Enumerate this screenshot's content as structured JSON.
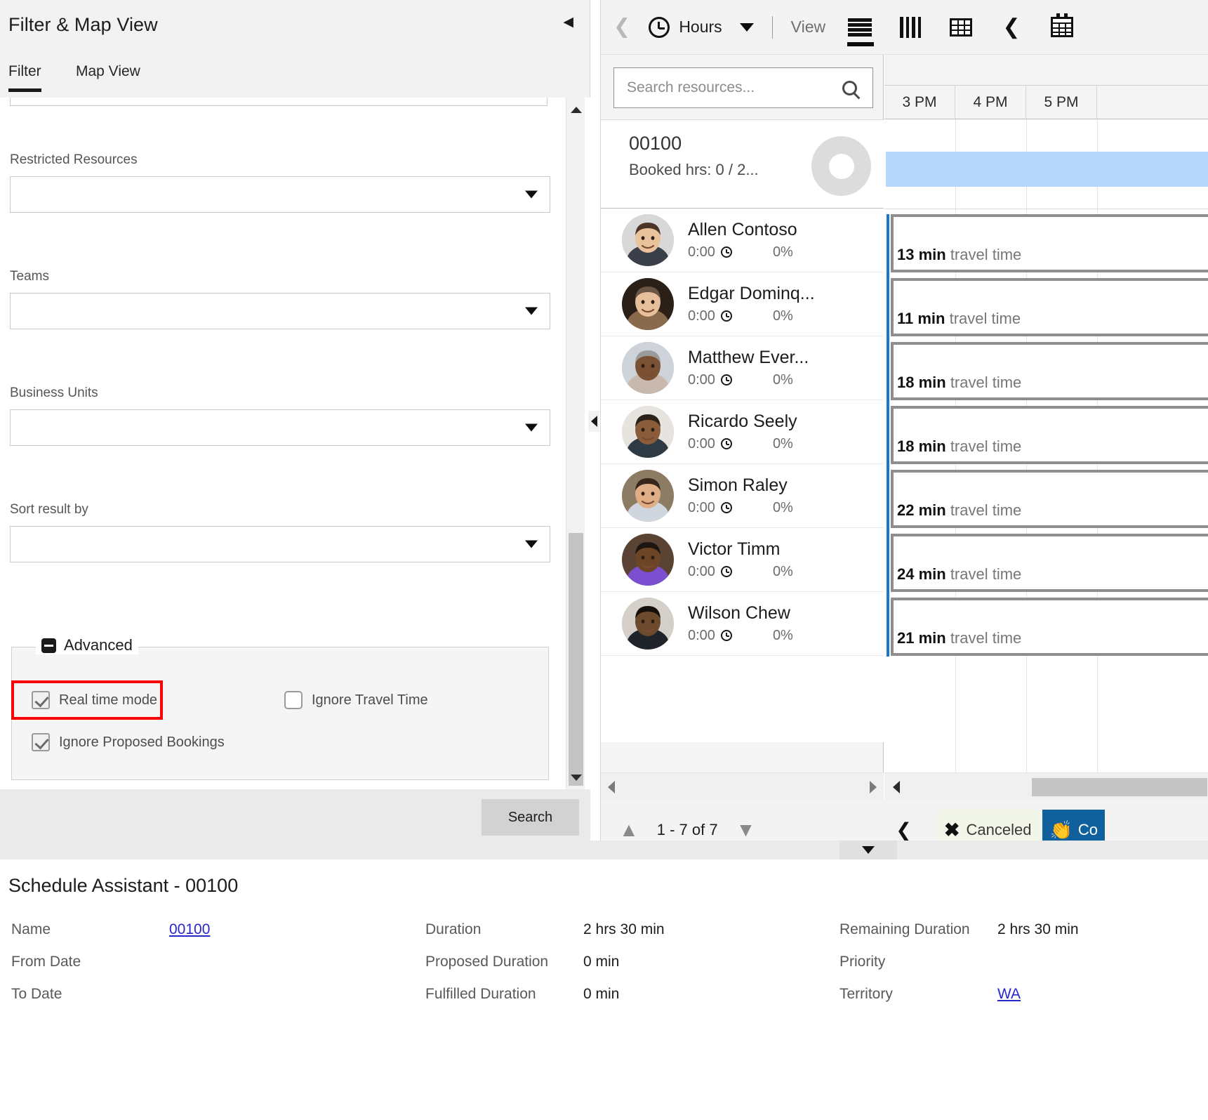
{
  "left_panel": {
    "title": "Filter & Map View",
    "collapse_icon": "collapse-left-icon",
    "tabs": [
      {
        "label": "Filter",
        "active": true
      },
      {
        "label": "Map View",
        "active": false
      }
    ],
    "fields": [
      {
        "label": "Restricted Resources",
        "value": "",
        "caret": "chevron-down-icon"
      },
      {
        "label": "Teams",
        "value": "",
        "caret": "chevron-down-icon"
      },
      {
        "label": "Business Units",
        "value": "",
        "caret": "chevron-down-icon"
      },
      {
        "label": "Sort result by",
        "value": "",
        "caret": "chevron-down-icon"
      }
    ],
    "advanced": {
      "legend": "Advanced",
      "toggle_icon": "minus-square-icon",
      "checkboxes": [
        {
          "label": "Real time mode",
          "checked": true,
          "highlighted": true
        },
        {
          "label": "Ignore Travel Time",
          "checked": false,
          "highlighted": false
        },
        {
          "label": "Ignore Proposed Bookings",
          "checked": true,
          "highlighted": false
        }
      ],
      "highlight_color": "#ff0000"
    },
    "search_button": "Search"
  },
  "toolbar": {
    "back_icon": "chevron-left-icon",
    "clock_icon": "clock-icon",
    "unit_label": "Hours",
    "unit_caret": "chevron-down-icon",
    "view_label": "View",
    "view_buttons": [
      {
        "name": "list-view",
        "icon": "list-icon",
        "active": true
      },
      {
        "name": "columns-view",
        "icon": "columns-icon",
        "active": false
      },
      {
        "name": "grid-view",
        "icon": "grid-icon",
        "active": false
      },
      {
        "name": "previous-period",
        "icon": "chevron-left-icon",
        "active": false
      },
      {
        "name": "calendar-view",
        "icon": "calendar-icon",
        "active": false
      }
    ]
  },
  "resources": {
    "search_placeholder": "Search resources...",
    "search_value": "",
    "search_icon": "search-icon",
    "header": {
      "code": "00100",
      "booked": "Booked hrs: 0 / 2..."
    },
    "items": [
      {
        "name": "Allen Contoso",
        "hours": "0:00",
        "pct": "0%",
        "skin": "#e8c39c",
        "hair": "#4a3526",
        "shirt": "#3b3f4a",
        "bg": "#d8d8d8"
      },
      {
        "name": "Edgar Dominq...",
        "hours": "0:00",
        "pct": "0%",
        "skin": "#e8bf9b",
        "hair": "#6b5646",
        "shirt": "#8a6a4c",
        "bg": "#2a2018"
      },
      {
        "name": "Matthew Ever...",
        "hours": "0:00",
        "pct": "0%",
        "skin": "#7a5233",
        "hair": "#9b9b9b",
        "shirt": "#c9b8ae",
        "bg": "#cdd3d8"
      },
      {
        "name": "Ricardo Seely",
        "hours": "0:00",
        "pct": "0%",
        "skin": "#8a5c39",
        "hair": "#2b2118",
        "shirt": "#2f3b44",
        "bg": "#e7e3de"
      },
      {
        "name": "Simon Raley",
        "hours": "0:00",
        "pct": "0%",
        "skin": "#dfae86",
        "hair": "#36261b",
        "shirt": "#cfd6dd",
        "bg": "#8d7c64"
      },
      {
        "name": "Victor Timm",
        "hours": "0:00",
        "pct": "0%",
        "skin": "#6b4526",
        "hair": "#1d1510",
        "shirt": "#7b4fcf",
        "bg": "#5b4334"
      },
      {
        "name": "Wilson Chew",
        "hours": "0:00",
        "pct": "0%",
        "skin": "#6e4a2c",
        "hair": "#15100c",
        "shirt": "#1f242b",
        "bg": "#d4cfc8"
      }
    ],
    "clock_icon": "clock-icon",
    "scroll_left_icon": "scroll-left-icon",
    "scroll_right_icon": "scroll-right-icon"
  },
  "timeline": {
    "hours": [
      "3 PM",
      "4 PM",
      "5 PM"
    ],
    "travel_rows": [
      {
        "minutes": "13 min",
        "suffix": "travel time"
      },
      {
        "minutes": "11 min",
        "suffix": "travel time"
      },
      {
        "minutes": "18 min",
        "suffix": "travel time"
      },
      {
        "minutes": "18 min",
        "suffix": "travel time"
      },
      {
        "minutes": "22 min",
        "suffix": "travel time"
      },
      {
        "minutes": "24 min",
        "suffix": "travel time"
      },
      {
        "minutes": "21 min",
        "suffix": "travel time"
      }
    ],
    "highlight_color": "#b6d7fb",
    "marker_color": "#1878d0",
    "scroll_left_icon": "scroll-left-icon"
  },
  "status_bar": {
    "page_up_icon": "chevron-up-icon",
    "page_down_icon": "chevron-down-icon",
    "record_count": "1 - 7 of 7",
    "prev_icon": "chevron-left-icon",
    "canceled": {
      "icon": "close-x-icon",
      "label": "Canceled",
      "bg": "#f1f6e8"
    },
    "complete": {
      "icon": "handshake-icon",
      "label": "Co",
      "bg": "#10609e"
    },
    "expander_icon": "chevron-down-icon"
  },
  "detail": {
    "title": "Schedule Assistant - 00100",
    "column1": [
      {
        "label": "Name",
        "value": "00100",
        "is_link": true
      },
      {
        "label": "From Date",
        "value": "",
        "is_link": false
      },
      {
        "label": "To Date",
        "value": "",
        "is_link": false
      }
    ],
    "column2": [
      {
        "label": "Duration",
        "value": "2 hrs 30 min",
        "is_link": false
      },
      {
        "label": "Proposed Duration",
        "value": "0 min",
        "is_link": false
      },
      {
        "label": "Fulfilled Duration",
        "value": "0 min",
        "is_link": false
      }
    ],
    "column3": [
      {
        "label": "Remaining Duration",
        "value": "2 hrs 30 min",
        "is_link": false
      },
      {
        "label": "Priority",
        "value": "",
        "is_link": false
      },
      {
        "label": "Territory",
        "value": "WA",
        "is_link": true
      }
    ]
  }
}
